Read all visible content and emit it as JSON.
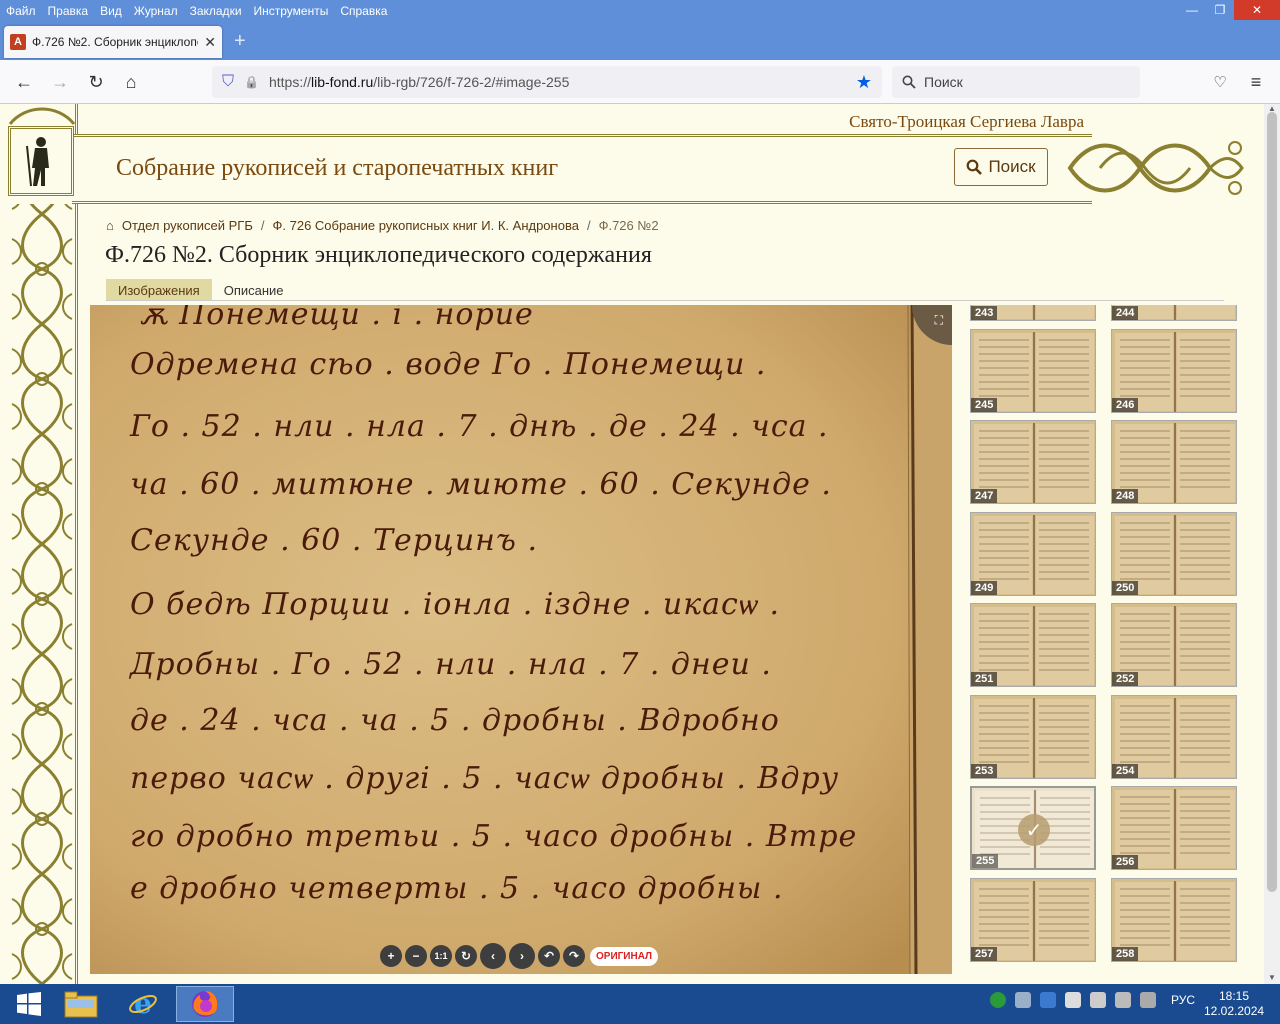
{
  "menu": [
    "Файл",
    "Правка",
    "Вид",
    "Журнал",
    "Закладки",
    "Инструменты",
    "Справка"
  ],
  "window_controls": {
    "minimize": "—",
    "maximize": "❐",
    "close": "✕"
  },
  "tab": {
    "favicon": "A",
    "title": "Ф.726 №2. Сборник энциклопе",
    "close": "✕",
    "new": "+"
  },
  "nav": {
    "back": "←",
    "forward": "→",
    "reload": "↻",
    "home": "⌂",
    "shield": "⛉",
    "lock": "🔒",
    "url_prefix": "https://",
    "url_domain": "lib-fond.ru",
    "url_path": "/lib-rgb/726/f-726-2/#image-255",
    "bookmark": "★",
    "search_placeholder": "Поиск",
    "pocket": "♡",
    "menu": "≡"
  },
  "site": {
    "lavra": "Свято-Троицкая Сергиева Лавра",
    "title": "Собрание рукописей и старопечатных книг",
    "search_button": "Поиск"
  },
  "breadcrumbs": [
    {
      "label": "Отдел рукописей РГБ",
      "icon": "home-icon"
    },
    {
      "label": "Ф. 726 Собрание рукописных книг И. К. Андронова"
    },
    {
      "label": "Ф.726 №2"
    }
  ],
  "page_title": "Ф.726 №2. Сборник энциклопедического содержания",
  "tabs": [
    {
      "label": "Изображения",
      "active": true
    },
    {
      "label": "Описание",
      "active": false
    }
  ],
  "viewer": {
    "lines": [
      "ѫ Понемещи . і . норие",
      "Одремена сѣо . воде Го . Понемещи .",
      "Го . 52 . нли . нла . 7 . днѣ . де . 24 . чса .",
      "ча . 60 . митюне . миюте . 60 . Секунде .",
      "Секунде . 60 . Терцинъ .",
      "О бедѣ Порции . іонла . іздне . икасѡ .",
      "Дробны . Го . 52 . нли . нла . 7 . днеи .",
      "де . 24 . чса . ча . 5 . дробны . Вдробно",
      "перво часѡ . другі . 5 . часѡ дробны . Вдру",
      "го дробно третьи . 5 . часо дробны . Втре",
      "е дробно четверты . 5 . часо дробны ."
    ],
    "fullscreen": "⛶",
    "controls": [
      "+",
      "−",
      "1:1",
      "↻",
      "‹",
      "›",
      "↶",
      "↷"
    ],
    "original": "ОРИГИНАЛ"
  },
  "thumbnails": [
    {
      "num": "243"
    },
    {
      "num": "244"
    },
    {
      "num": "245"
    },
    {
      "num": "246"
    },
    {
      "num": "247"
    },
    {
      "num": "248"
    },
    {
      "num": "249"
    },
    {
      "num": "250"
    },
    {
      "num": "251"
    },
    {
      "num": "252"
    },
    {
      "num": "253"
    },
    {
      "num": "254"
    },
    {
      "num": "255",
      "selected": true
    },
    {
      "num": "256"
    },
    {
      "num": "257"
    },
    {
      "num": "258"
    }
  ],
  "tray": {
    "lang": "РУС",
    "time": "18:15",
    "date": "12.02.2024"
  },
  "colors": {
    "accent": "#7a4a10",
    "ornament": "#8a8030",
    "titlebar": "#5f8fd8",
    "taskbar": "#1a4a8f"
  }
}
